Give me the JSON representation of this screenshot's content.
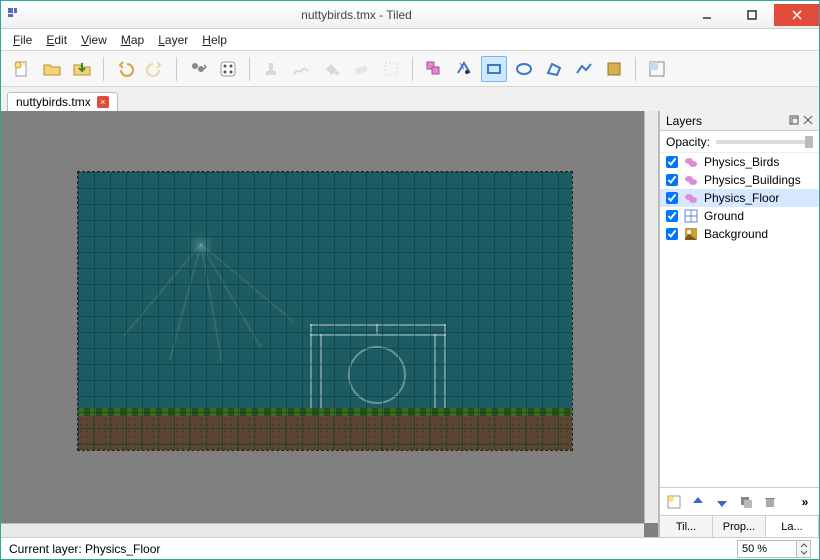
{
  "window": {
    "title": "nuttybirds.tmx - Tiled"
  },
  "menu": {
    "file": "File",
    "edit": "Edit",
    "view": "View",
    "map": "Map",
    "layer": "Layer",
    "help": "Help"
  },
  "tab": {
    "name": "nuttybirds.tmx"
  },
  "layers_panel": {
    "title": "Layers",
    "opacity_label": "Opacity:",
    "items": [
      {
        "name": "Physics_Birds",
        "checked": true,
        "type": "object"
      },
      {
        "name": "Physics_Buildings",
        "checked": true,
        "type": "object"
      },
      {
        "name": "Physics_Floor",
        "checked": true,
        "type": "object",
        "selected": true
      },
      {
        "name": "Ground",
        "checked": true,
        "type": "tile"
      },
      {
        "name": "Background",
        "checked": true,
        "type": "image"
      }
    ]
  },
  "bottom_tabs": {
    "tilesets": "Til...",
    "properties": "Prop...",
    "layers": "La..."
  },
  "status": {
    "current_layer_label": "Current layer: Physics_Floor",
    "zoom": "50 %"
  },
  "colors": {
    "accent": "#2aa89c",
    "obj_icon": "#e08ad8",
    "tile_icon": "#5b87d4",
    "img_icon": "#c8a038"
  }
}
